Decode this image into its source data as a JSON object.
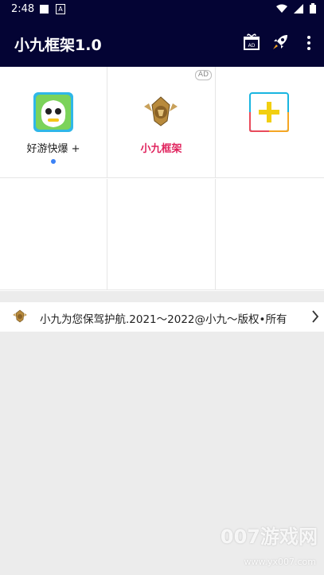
{
  "status_bar": {
    "time": "2:48"
  },
  "app_bar": {
    "title": "小九框架1.0",
    "gift_badge": "AD"
  },
  "grid": {
    "items": [
      {
        "label": "好游快爆 +",
        "has_dot": true
      },
      {
        "label": "小九框架",
        "ad_badge": "AD"
      },
      {
        "label": ""
      }
    ]
  },
  "notice": {
    "text": "小九为您保驾护航.2021～2022@小九～版权•所有"
  },
  "watermark": {
    "text": "007游戏网",
    "url": "www.yx007.com"
  },
  "colors": {
    "app_bar": "#040434",
    "accent_label": "#e0245e",
    "dot": "#3b82f6"
  }
}
